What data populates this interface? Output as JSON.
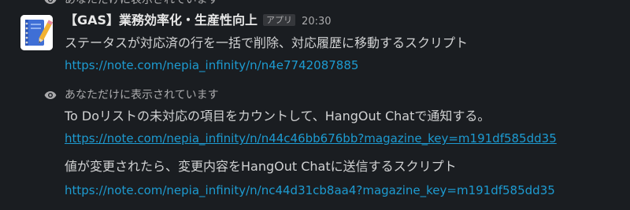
{
  "top_notice": {
    "text": "あなただけに表示されています"
  },
  "message1": {
    "sender": "【GAS】業務効率化・生産性向上",
    "badge": "アプリ",
    "time": "20:30",
    "text": "ステータスが対応済の行を一括で削除、対応履歴に移動するスクリプト",
    "link": "https://note.com/nepia_infinity/n/n4e7742087885"
  },
  "message2": {
    "notice": "あなただけに表示されています",
    "text": "To Doリストの未対応の項目をカウントして、HangOut Chatで通知する。",
    "link": "https://note.com/nepia_infinity/n/n44c46bb676bb?magazine_key=m191df585dd35",
    "text2": "値が変更されたら、変更内容をHangOut Chatに送信するスクリプト",
    "link2": "https://note.com/nepia_infinity/n/nc44d31cb8aa4?magazine_key=m191df585dd35"
  },
  "icons": {
    "visibility": "eye-icon",
    "avatar": "notebook-pencil-icon"
  },
  "colors": {
    "background": "#1a1d21",
    "text": "#d1d2d3",
    "muted": "#ababad",
    "link": "#1d9bd1"
  }
}
